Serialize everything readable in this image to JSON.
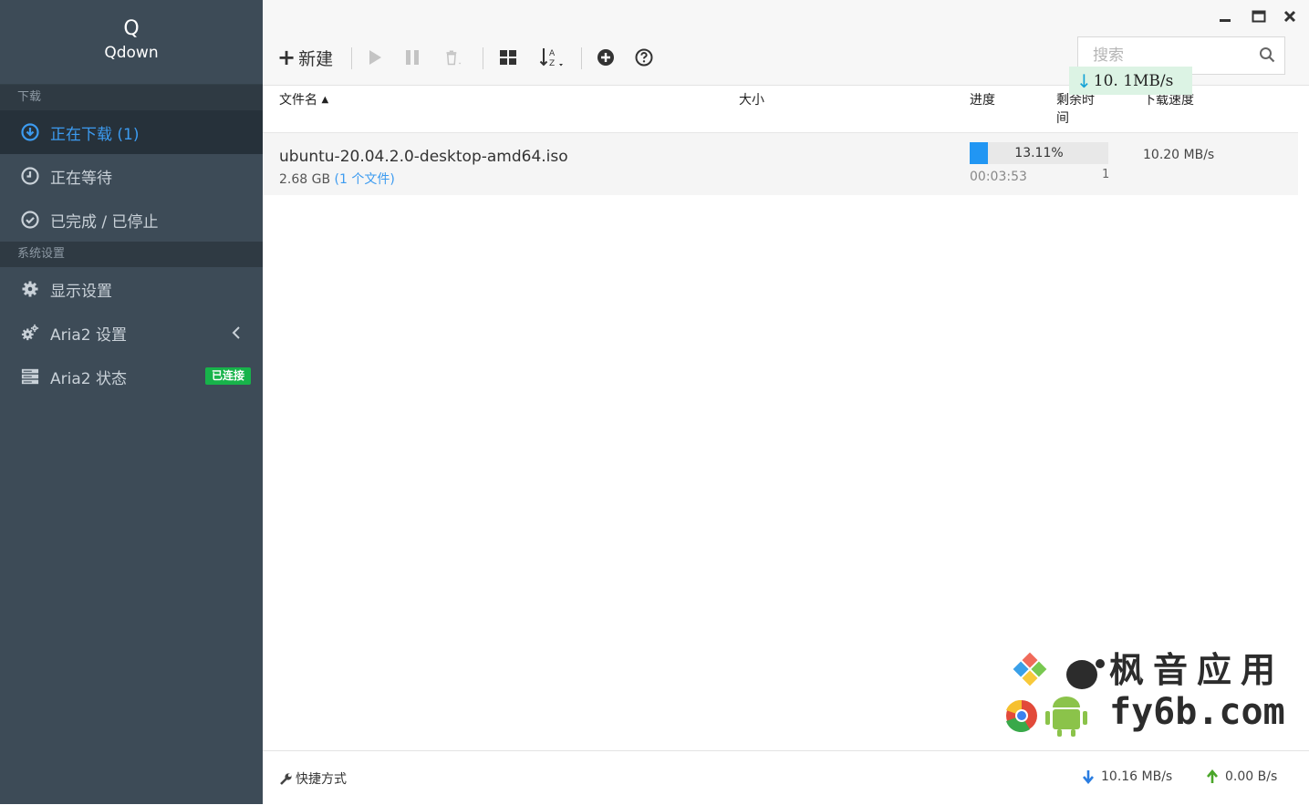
{
  "app": {
    "logo_letter": "Q",
    "name": "Qdown"
  },
  "sidebar": {
    "section_download": "下载",
    "downloading": "正在下载 (1)",
    "waiting": "正在等待",
    "finished": "已完成 / 已停止",
    "section_settings": "系统设置",
    "display_settings": "显示设置",
    "aria2_settings": "Aria2 设置",
    "aria2_status": "Aria2 状态",
    "aria2_status_badge": "已连接"
  },
  "toolbar": {
    "new_label": "新建"
  },
  "search": {
    "placeholder": "搜索"
  },
  "speed_tooltip": "10. 1MB/s",
  "table": {
    "headers": {
      "name": "文件名",
      "size": "大小",
      "progress": "进度",
      "remaining": "剩余时间",
      "speed": "下载速度"
    },
    "rows": [
      {
        "name": "ubuntu-20.04.2.0-desktop-amd64.iso",
        "size": "2.68 GB",
        "files": "(1 个文件)",
        "progress": 0.1311,
        "progress_text": "13.11%",
        "remaining": "00:03:53",
        "connections": "1",
        "speed": "10.20 MB/s"
      }
    ]
  },
  "footer": {
    "shortcut": "快捷方式",
    "download_speed": "10.16 MB/s",
    "upload_speed": "0.00 B/s"
  },
  "watermark": {
    "line1": "枫音应用",
    "line2": "fy6b.com"
  },
  "colors": {
    "sidebar_bg": "#3d4b57",
    "active_blue": "#3c9bf0",
    "badge_green": "#17b34a",
    "progress_blue": "#2196f3"
  }
}
